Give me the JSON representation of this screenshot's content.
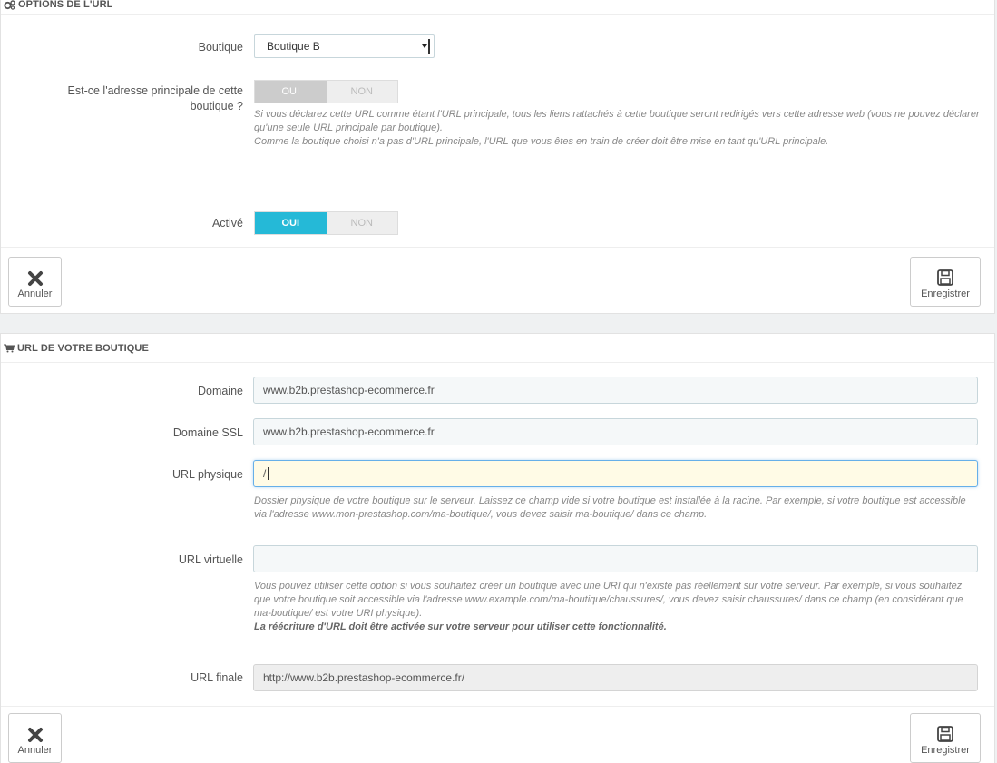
{
  "section1": {
    "title": "OPTIONS DE L'URL",
    "shop_label": "Boutique",
    "shop_value": "Boutique B",
    "main_label": "Est-ce l'adresse principale de cette boutique ?",
    "main_toggle": {
      "yes": "OUI",
      "no": "NON"
    },
    "main_help_1": "Si vous déclarez cette URL comme étant l'URL principale, tous les liens rattachés à cette boutique seront redirigés vers cette adresse web (vous ne pouvez déclarer qu'une seule URL principale par boutique).",
    "main_help_2": "Comme la boutique choisi n'a pas d'URL principale, l'URL que vous êtes en train de créer doit être mise en tant qu'URL principale.",
    "active_label": "Activé",
    "active_toggle": {
      "yes": "OUI",
      "no": "NON"
    },
    "cancel_label": "Annuler",
    "save_label": "Enregistrer"
  },
  "section2": {
    "title": "URL DE VOTRE BOUTIQUE",
    "domain_label": "Domaine",
    "domain_value": "www.b2b.prestashop-ecommerce.fr",
    "ssl_label": "Domaine SSL",
    "ssl_value": "www.b2b.prestashop-ecommerce.fr",
    "physical_label": "URL physique",
    "physical_value": "/",
    "physical_help": "Dossier physique de votre boutique sur le serveur. Laissez ce champ vide si votre boutique est installée à la racine. Par exemple, si votre boutique est accessible via l'adresse www.mon-prestashop.com/ma-boutique/, vous devez saisir ma-boutique/ dans ce champ.",
    "virtual_label": "URL virtuelle",
    "virtual_value": "",
    "virtual_help": "Vous pouvez utiliser cette option si vous souhaitez créer un boutique avec une URI qui n'existe pas réellement sur votre serveur. Par exemple, si vous souhaitez que votre boutique soit accessible via l'adresse www.example.com/ma-boutique/chaussures/, vous devez saisir chaussures/ dans ce champ (en considérant que ma-boutique/ est votre URI physique).",
    "virtual_help_bold": "La réécriture d'URL doit être activée sur votre serveur pour utiliser cette fonctionnalité.",
    "final_label": "URL finale",
    "final_value": "http://www.b2b.prestashop-ecommerce.fr/",
    "cancel_label": "Annuler",
    "save_label": "Enregistrer"
  },
  "colors": {
    "accent": "#25b9d7",
    "focus_bg": "#fffbe6"
  },
  "icons": [
    "cogs-icon",
    "cart-icon",
    "close-icon",
    "save-icon"
  ]
}
